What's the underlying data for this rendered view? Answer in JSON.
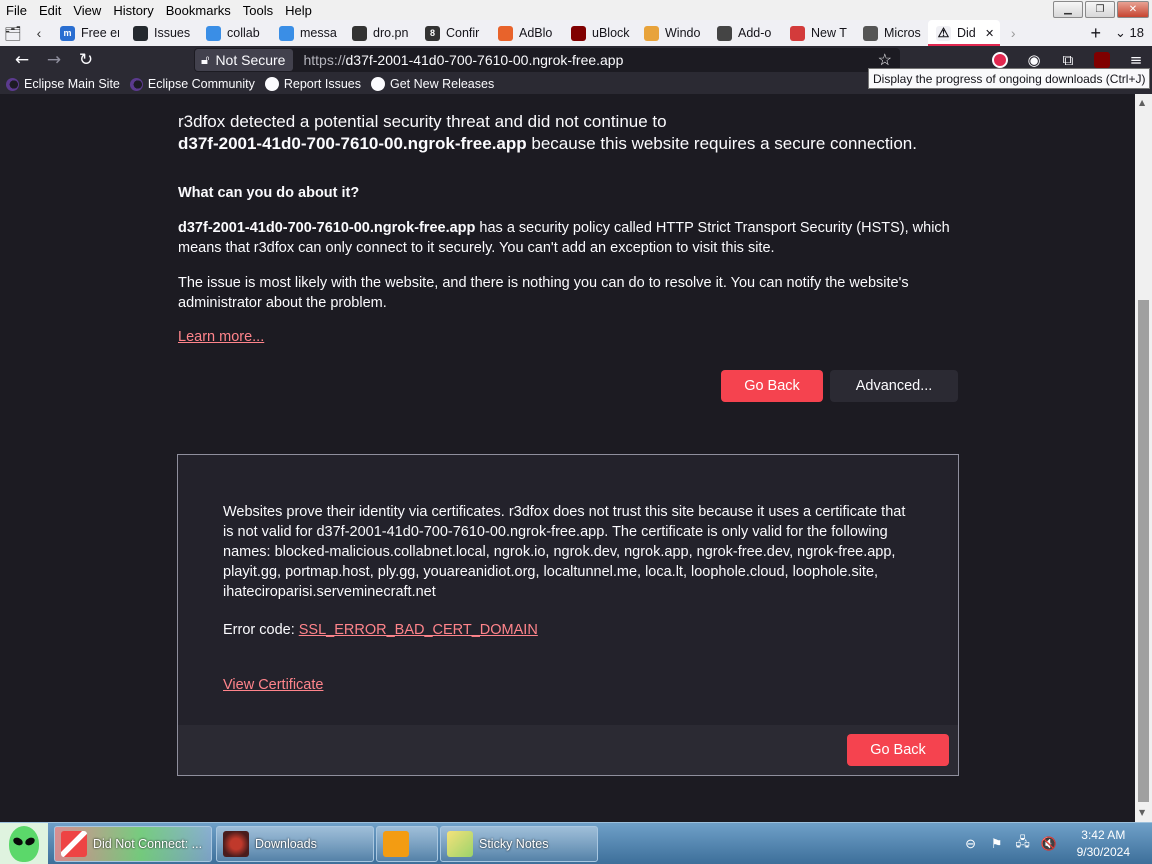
{
  "menubar": {
    "items": [
      "File",
      "Edit",
      "View",
      "History",
      "Bookmarks",
      "Tools",
      "Help"
    ]
  },
  "tabs": [
    {
      "label": "Free er",
      "fav_color": "#2a6ed1",
      "fav_glyph": "m"
    },
    {
      "label": "Issues",
      "fav_color": "#24292f",
      "fav_glyph": ""
    },
    {
      "label": "collab",
      "fav_color": "#3a8ee6",
      "fav_glyph": ""
    },
    {
      "label": "messa",
      "fav_color": "#3a8ee6",
      "fav_glyph": ""
    },
    {
      "label": "dro.pn",
      "fav_color": "#333333",
      "fav_glyph": ""
    },
    {
      "label": "Confir",
      "fav_color": "#333333",
      "fav_glyph": "8"
    },
    {
      "label": "AdBlo",
      "fav_color": "#e8632b",
      "fav_glyph": ""
    },
    {
      "label": "uBlock",
      "fav_color": "#800000",
      "fav_glyph": ""
    },
    {
      "label": "Windo",
      "fav_color": "#e8a33b",
      "fav_glyph": ""
    },
    {
      "label": "Add-o",
      "fav_color": "#444444",
      "fav_glyph": ""
    },
    {
      "label": "New T",
      "fav_color": "#d33b3b",
      "fav_glyph": ""
    },
    {
      "label": "Micros",
      "fav_color": "#555555",
      "fav_glyph": ""
    },
    {
      "label": "Did",
      "fav_color": "#f0f0f4",
      "fav_glyph": "⚠",
      "active": true
    }
  ],
  "tabstrip": {
    "tab_count": "18"
  },
  "navbar": {
    "security_label": "Not Secure",
    "url_prefix": "https://",
    "url_host": "d37f-2001-41d0-700-7610-00.ngrok-free.app"
  },
  "bookmarks": [
    {
      "label": "Eclipse Main Site",
      "icon": "eclipse"
    },
    {
      "label": "Eclipse Community",
      "icon": "eclipse"
    },
    {
      "label": "Report Issues",
      "icon": "github"
    },
    {
      "label": "Get New Releases",
      "icon": "github"
    }
  ],
  "tooltip": "Display the progress of ongoing downloads (Ctrl+J)",
  "error": {
    "intro_line1": "r3dfox detected a potential security threat and did not continue to",
    "intro_host": "d37f-2001-41d0-700-7610-00.ngrok-free.app",
    "intro_line2_rest": " because this website requires a secure connection.",
    "heading": "What can you do about it?",
    "p1_host": "d37f-2001-41d0-700-7610-00.ngrok-free.app",
    "p1_rest": " has a security policy called HTTP Strict Transport Security (HSTS), which means that r3dfox can only connect to it securely. You can't add an exception to visit this site.",
    "p2": "The issue is most likely with the website, and there is nothing you can do to resolve it. You can notify the website's administrator about the problem.",
    "learn_more": "Learn more...",
    "go_back": "Go Back",
    "advanced": "Advanced...",
    "adv_text": "Websites prove their identity via certificates. r3dfox does not trust this site because it uses a certificate that is not valid for d37f-2001-41d0-700-7610-00.ngrok-free.app. The certificate is only valid for the following names: blocked-malicious.collabnet.local, ngrok.io, ngrok.dev, ngrok.app, ngrok-free.dev, ngrok-free.app, playit.gg, portmap.host, ply.gg, youareanidiot.org, localtunnel.me, loca.lt, loophole.cloud, loophole.site, ihateciroparisi.serveminecraft.net",
    "error_code_label": "Error code: ",
    "error_code": "SSL_ERROR_BAD_CERT_DOMAIN",
    "view_certificate": "View Certificate",
    "go_back_2": "Go Back"
  },
  "taskbar": {
    "tasks": [
      {
        "label": "Did Not Connect: ...",
        "active": true
      },
      {
        "label": "Downloads",
        "active": false
      },
      {
        "label": "",
        "active": false
      },
      {
        "label": "Sticky Notes",
        "active": false
      }
    ],
    "time": "3:42 AM",
    "date": "9/30/2024"
  },
  "colors": {
    "accent": "#f5434f",
    "link": "#ff848b",
    "page_bg": "#1c1b22",
    "toolbar_bg": "#2b2a33"
  }
}
